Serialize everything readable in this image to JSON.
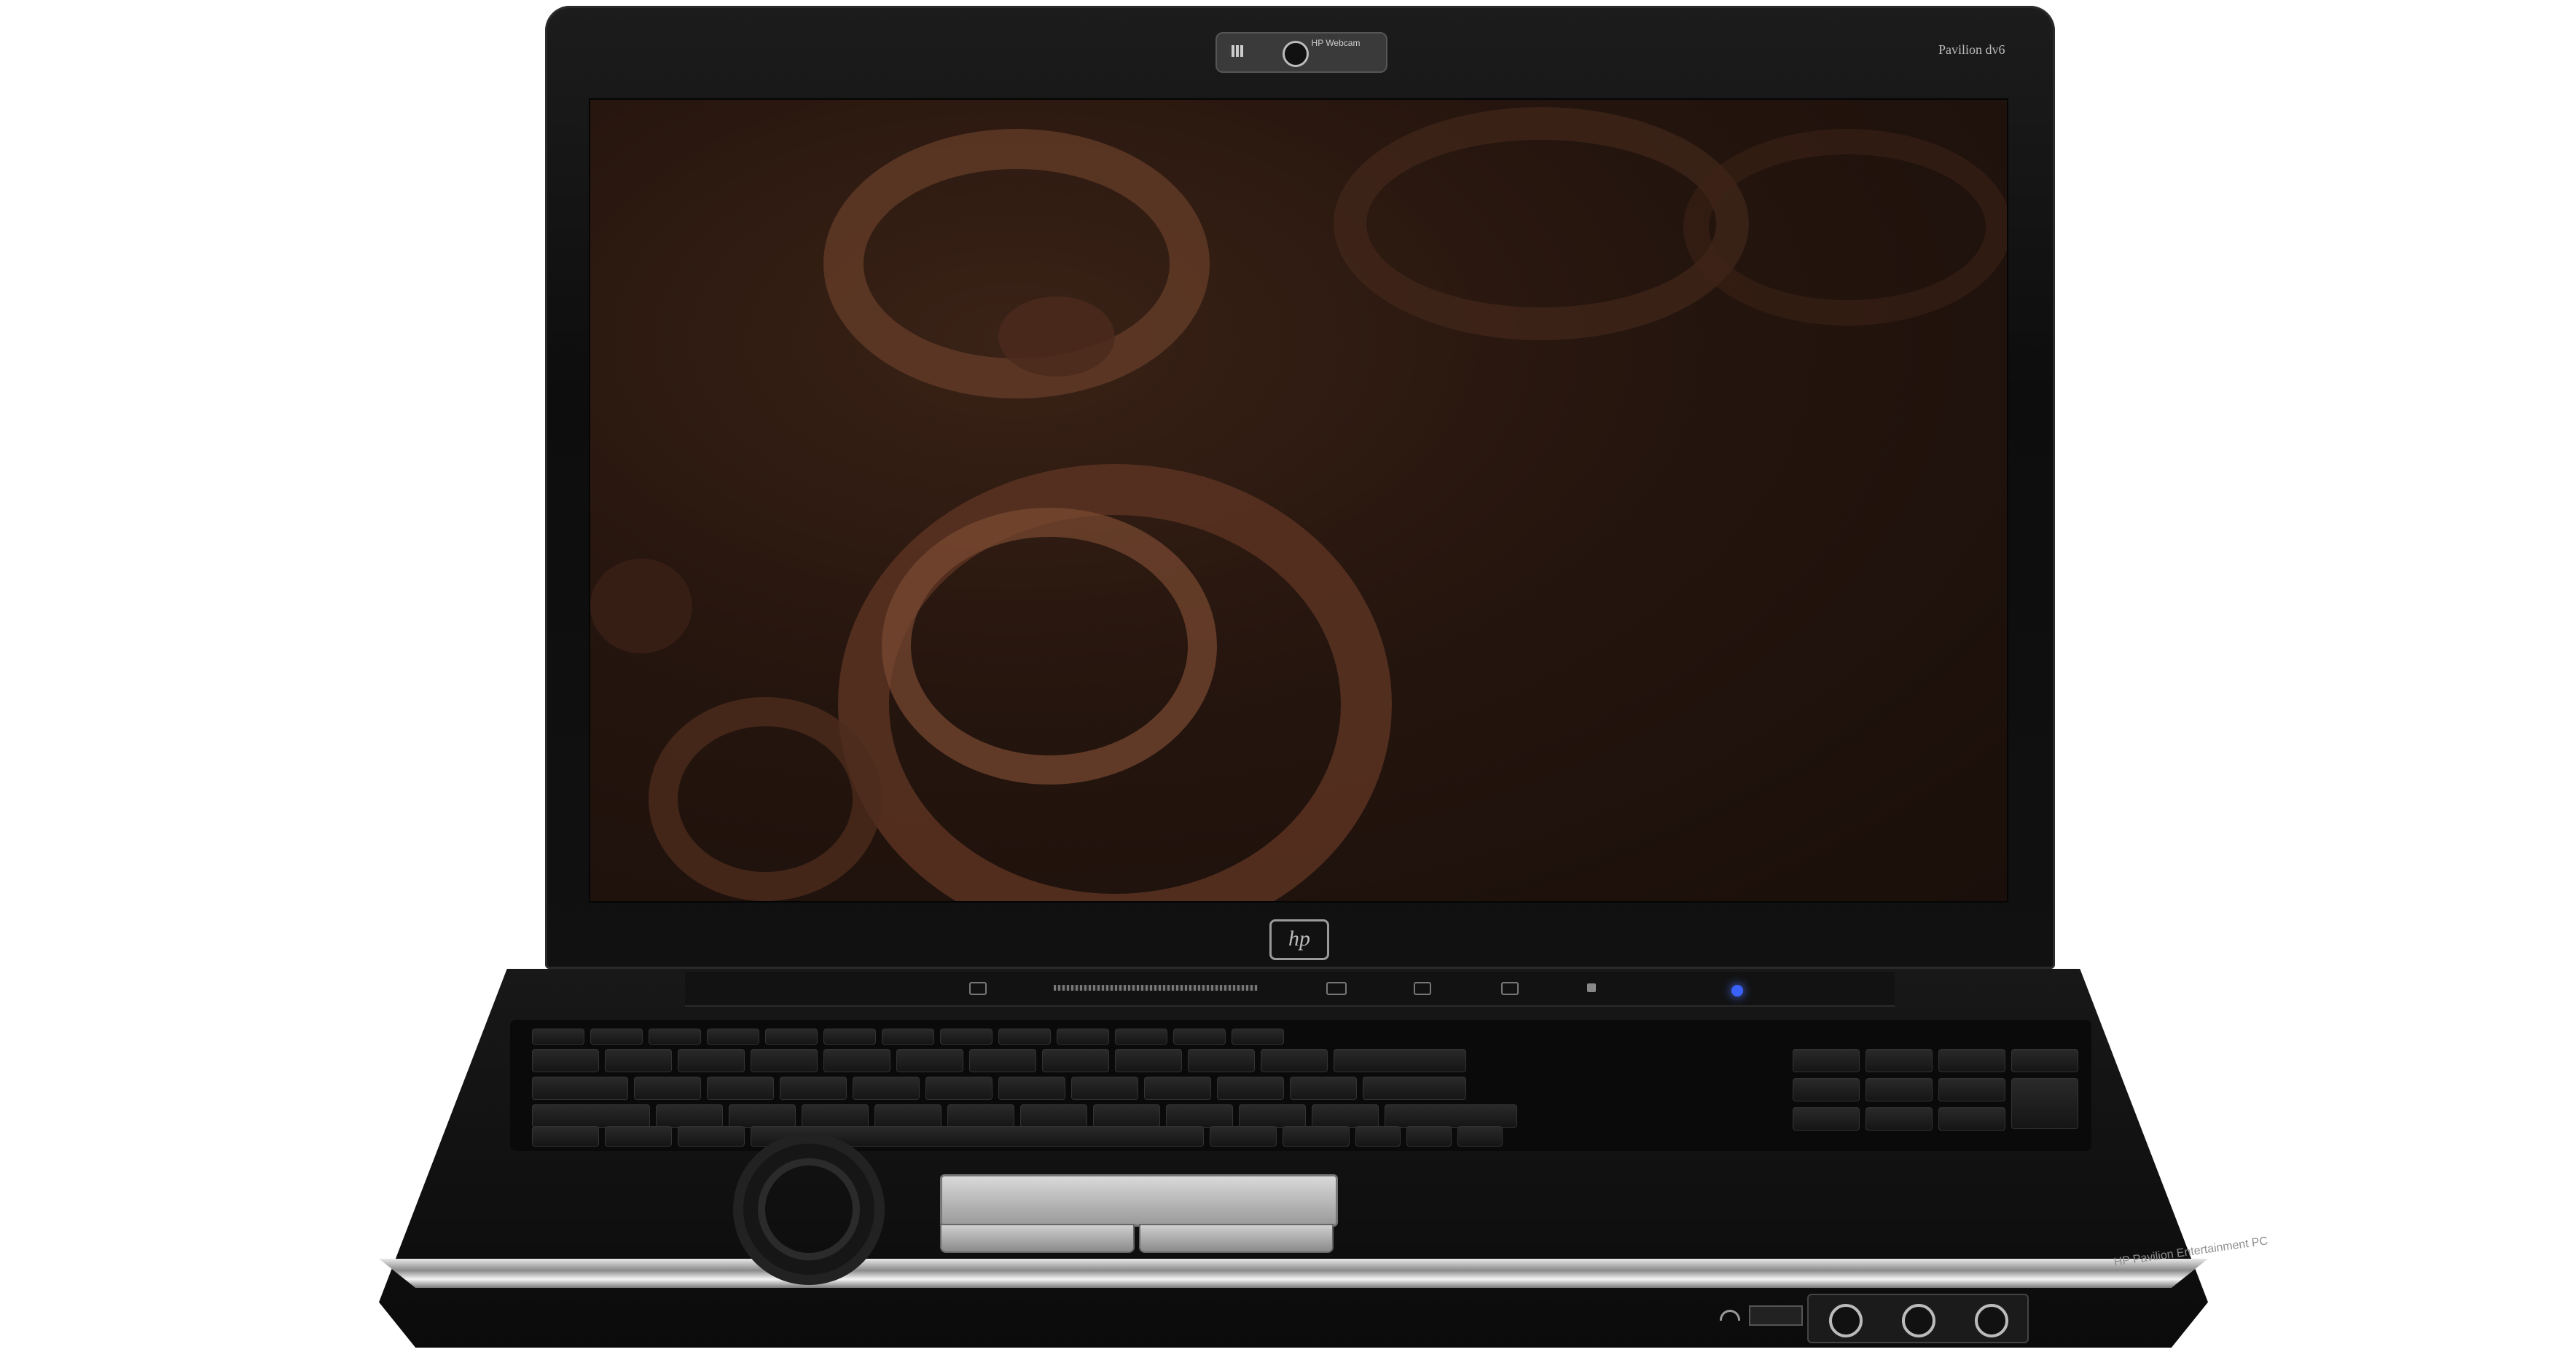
{
  "device": {
    "webcam_label": "HP Webcam",
    "model_label": "Pavilion dv6",
    "logo_text": "hp",
    "base_brand_text": "HP Pavilion Entertainment PC"
  },
  "colors": {
    "lid": "#111111",
    "wallpaper": "#25150e",
    "accent_led": "#3a62ff",
    "chrome": "#cfcfcf"
  }
}
